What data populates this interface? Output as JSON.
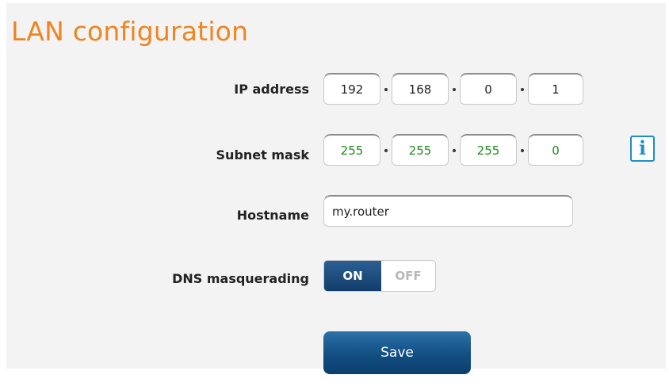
{
  "title": "LAN configuration",
  "ip_address": {
    "label": "IP address",
    "octets": [
      "192",
      "168",
      "0",
      "1"
    ]
  },
  "subnet_mask": {
    "label": "Subnet mask",
    "octets": [
      "255",
      "255",
      "255",
      "0"
    ],
    "info_icon": "info-icon"
  },
  "hostname": {
    "label": "Hostname",
    "value": "my.router"
  },
  "dns_masquerading": {
    "label": "DNS masquerading",
    "on_label": "ON",
    "off_label": "OFF",
    "state": "ON"
  },
  "save_label": "Save",
  "colors": {
    "title": "#ef8421",
    "mask_text": "#1e8a1e",
    "info_blue": "#1d8fc9",
    "button_blue": "#124e82"
  }
}
